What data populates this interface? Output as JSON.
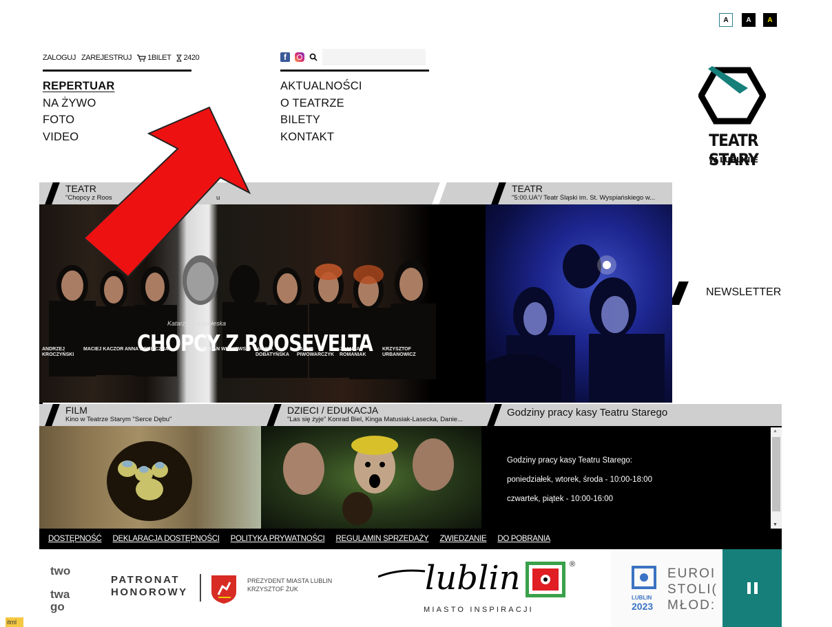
{
  "accessibility": {
    "contrast_buttons": [
      "A",
      "A",
      "A"
    ]
  },
  "userbar": {
    "login": "ZALOGUJ",
    "register": "ZAREJESTRUJ",
    "cart": "1BILET",
    "timer": "2420"
  },
  "search": {
    "placeholder": ""
  },
  "nav_left": [
    "REPERTUAR",
    "NA ŻYWO",
    "FOTO",
    "VIDEO"
  ],
  "nav_right": [
    "AKTUALNOŚCI",
    "O TEATRZE",
    "BILETY",
    "KONTAKT"
  ],
  "logo": {
    "title": "TEATR STARY",
    "subtitle": "W LUBLINIE"
  },
  "newsletter": "NEWSLETTER",
  "tiles": {
    "t1": {
      "category": "TEATR",
      "subtitle": "\"Chopcy z Roos",
      "subtitle_tail": "u",
      "poster_title": "CHOPCY Z ROOSEVELTA",
      "poster_author": "Katarzyna Kopołeska",
      "cast": [
        "ANDRZEJ KROCZYŃSKI",
        "MACIEJ KACZOR",
        "ANNA KONIECZNA",
        "MARIAN WIŚNIEWSKI",
        "HANNA DOBATYŃSKA",
        "JAKUB PIWOWARCZYK",
        "JOANNA ROMANIAK",
        "KRZYSZTOF URBANOWICZ"
      ]
    },
    "t2": {
      "category": "TEATR",
      "subtitle": "\"5:00.UA\"/ Teatr Śląski im. St. Wyspiańskiego w..."
    },
    "t3": {
      "category": "FILM",
      "subtitle": "Kino w Teatrze Starym \"Serce Dębu\""
    },
    "t4": {
      "category": "DZIECI / EDUKACJA",
      "subtitle": "\"Las się żyje\" Konrad Biel, Kinga Matusiak-Lasecka, Danie..."
    },
    "t5": {
      "title": "Godziny pracy kasy Teatru Starego",
      "lines": [
        "Godziny pracy kasy Teatru Starego:",
        "poniedziałek, wtorek, środa - 10:00-18:00",
        "czwartek, piątek - 10:00-16:00"
      ]
    }
  },
  "footer_links": [
    "DOSTĘPNOŚĆ",
    "DEKLARACJA DOSTĘPNOŚCI",
    "POLITYKA PRYWATNOŚCI",
    "REGULAMIN SPRZEDAŻY",
    "ZWIEDZANIE",
    "DO POBRANIA"
  ],
  "partners": {
    "left_fragment": [
      "two",
      "twa",
      "go"
    ],
    "patronat": [
      "PATRONAT",
      "HONOROWY"
    ],
    "president": [
      "PREZYDENT MIASTA LUBLIN",
      "KRZYSZTOF ŻUK"
    ],
    "lublin": "lublin",
    "lublin_sub": "MIASTO INSPIRACJI",
    "euro": [
      "EUROI",
      "STOLI(",
      "MŁOD:"
    ],
    "euro_year": [
      "LUBLIN",
      "2023"
    ]
  },
  "footer_tag": "itml",
  "colors": {
    "teal": "#167f7a",
    "red_arrow": "#ee1111",
    "header_gray": "#cfcfcf"
  }
}
